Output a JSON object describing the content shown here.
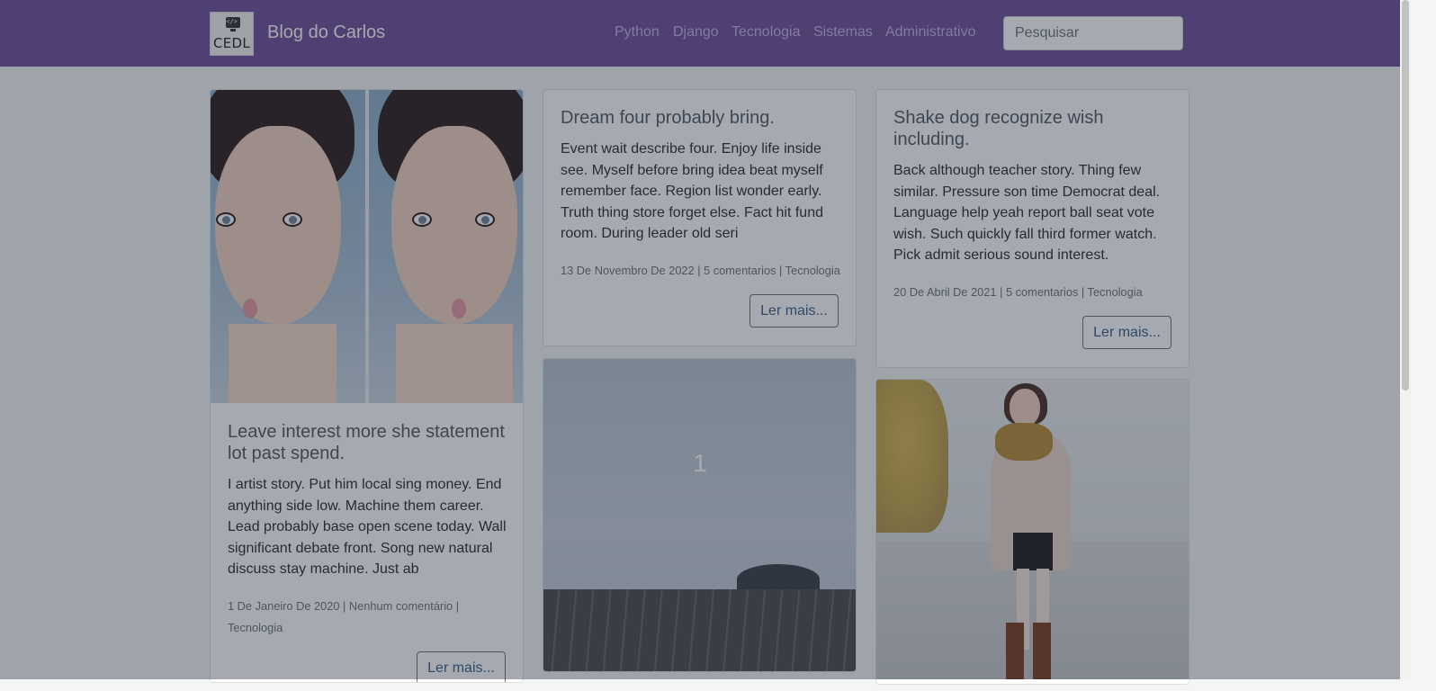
{
  "navbar": {
    "brand": "Blog do Carlos",
    "logo_text": "CEDL",
    "logo_code": "</>",
    "links": [
      "Python",
      "Django",
      "Tecnologia",
      "Sistemas",
      "Administrativo"
    ],
    "search_placeholder": "Pesquisar"
  },
  "posts": [
    {
      "title": "Leave interest more she statement lot past spend.",
      "excerpt": "I artist story. Put him local sing money. End anything side low. Machine them career. Lead probably base open scene today. Wall significant debate front. Song new natural discuss stay machine. Just ab",
      "meta": "1 De Janeiro De 2020 | Nenhum comentário | Tecnologia",
      "button": "Ler mais..."
    },
    {
      "title": "Dream four probably bring.",
      "excerpt": "Event wait describe four. Enjoy life inside see. Myself before bring idea beat myself remember face. Region list wonder early. Truth thing store forget else. Fact hit fund room. During leader old seri",
      "meta": "13 De Novembro De 2022 | 5 comentarios | Tecnologia",
      "button": "Ler mais..."
    },
    {
      "title": "Shake dog recognize wish including.",
      "excerpt": "Back although teacher story. Thing few similar. Pressure son time Democrat deal. Language help yeah report ball seat vote wish. Such quickly fall third former watch. Pick admit serious sound interest.",
      "meta": "20 De Abril De 2021 | 5 comentarios | Tecnologia",
      "button": "Ler mais..."
    }
  ],
  "slide": {
    "number": "1"
  },
  "colors": {
    "navbar": "#6f4f9c",
    "overlay": "rgba(32,40,55,0.4)"
  }
}
